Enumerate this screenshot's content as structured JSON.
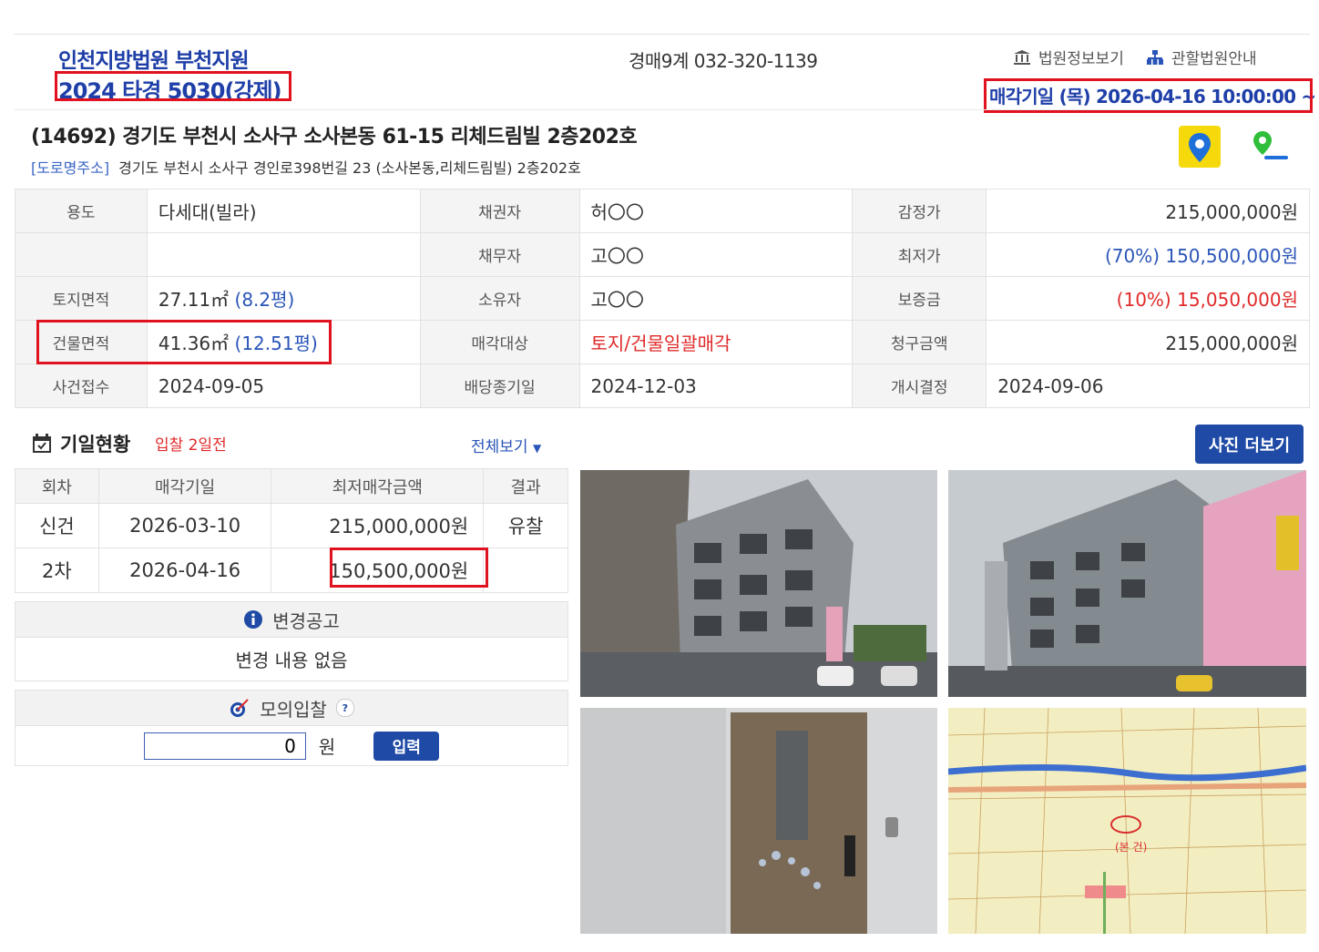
{
  "header": {
    "court": "인천지방법원 부천지원",
    "case_no": "2024 타경 5030(강제)",
    "dept": "경매9계 032-320-1139",
    "links": [
      {
        "label": "법원정보보기",
        "icon": "court-building-icon"
      },
      {
        "label": "관할법원안내",
        "icon": "org-chart-icon"
      }
    ],
    "sale_date": "매각기일 (목) 2026-04-16 10:00:00 ~"
  },
  "address": {
    "main": "(14692) 경기도 부천시 소사구 소사본동 61-15 리체드림빌 2층202호",
    "road_tag": "[도로명주소]",
    "road": "경기도 부천시 소사구 경인로398번길 23 (소사본동,리체드림빌) 2층202호"
  },
  "info": {
    "r1": {
      "h1": "용도",
      "v1": "다세대(빌라)",
      "h2": "채권자",
      "v2": "허〇〇",
      "h3": "감정가",
      "v3": "215,000,000원"
    },
    "r2": {
      "h1": "",
      "v1": "",
      "h2": "채무자",
      "v2": "고〇〇",
      "h3": "최저가",
      "v3": "(70%) 150,500,000원"
    },
    "r3": {
      "h1": "토지면적",
      "v1a": "27.11㎡",
      "v1b": "(8.2평)",
      "h2": "소유자",
      "v2": "고〇〇",
      "h3": "보증금",
      "v3": "(10%) 15,050,000원"
    },
    "r4": {
      "h1": "건물면적",
      "v1a": "41.36㎡",
      "v1b": "(12.51평)",
      "h2": "매각대상",
      "v2": "토지/건물일괄매각",
      "h3": "청구금액",
      "v3": "215,000,000원"
    },
    "r5": {
      "h1": "사건접수",
      "v1": "2024-09-05",
      "h2": "배당종기일",
      "v2": "2024-12-03",
      "h3": "개시결정",
      "v3": "2024-09-06"
    }
  },
  "schedule": {
    "title": "기일현황",
    "sub": "입찰 2일전",
    "view_all": "전체보기",
    "headers": [
      "회차",
      "매각기일",
      "최저매각금액",
      "결과"
    ],
    "rows": [
      [
        "신건",
        "2026-03-10",
        "215,000,000원",
        "유찰"
      ],
      [
        "2차",
        "2026-04-16",
        "150,500,000원",
        ""
      ]
    ]
  },
  "notice": {
    "title": "변경공고",
    "body": "변경 내용 없음"
  },
  "mockbid": {
    "title": "모의입찰",
    "help": "?",
    "value": "0",
    "unit": "원",
    "button": "입력"
  },
  "photos": {
    "more_button": "사진 더보기",
    "map_label": "(본 건)"
  },
  "colors": {
    "accent": "#1f4aa5",
    "highlight": "#e0121f",
    "link": "#2a55b8"
  }
}
